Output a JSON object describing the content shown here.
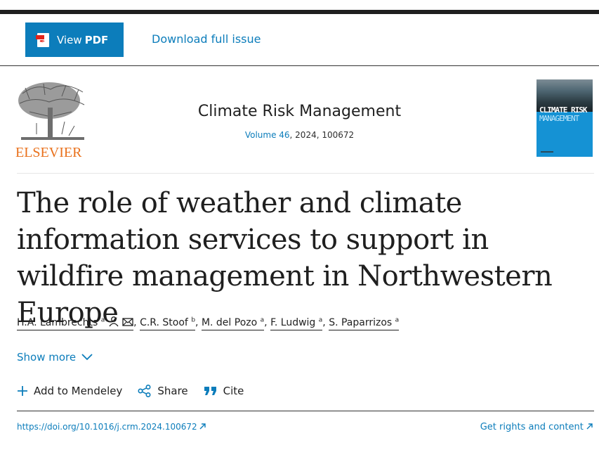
{
  "toolbar": {
    "pdf_label_prefix": "View",
    "pdf_label_bold": "PDF",
    "download_issue": "Download full issue"
  },
  "publisher": {
    "logo_text": "ELSEVIER"
  },
  "journal": {
    "title": "Climate Risk Management",
    "volume_label": "Volume 46",
    "volume_rest": ", 2024, 100672",
    "cover_line1": "CLIMATE RISK",
    "cover_line2": "MANAGEMENT"
  },
  "article": {
    "title": "The role of weather and climate information services to support in wildfire management in Northwestern Europe",
    "authors": [
      {
        "name": "H.A. Lambrechts",
        "sup": "a"
      },
      {
        "name": "C.R. Stoof",
        "sup": "b"
      },
      {
        "name": "M. del Pozo",
        "sup": "a"
      },
      {
        "name": "F. Ludwig",
        "sup": "a"
      },
      {
        "name": "S. Paparrizos",
        "sup": "a"
      }
    ]
  },
  "show_more": "Show more",
  "actions": {
    "mendeley": "Add to Mendeley",
    "share": "Share",
    "cite": "Cite"
  },
  "doi": "https://doi.org/10.1016/j.crm.2024.100672",
  "rights": "Get rights and content",
  "colors": {
    "accent": "#0c7dbb",
    "text": "#1f1f1f",
    "cover": "#1592d4",
    "elsevier": "#e9711c"
  }
}
